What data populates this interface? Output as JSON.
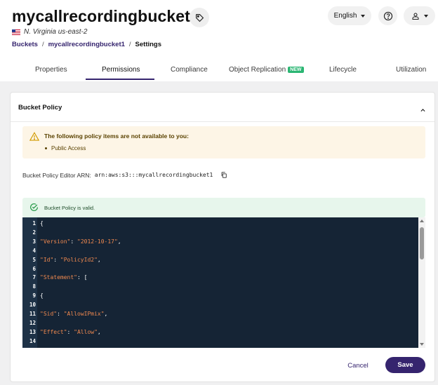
{
  "header": {
    "bucket_name": "mycallrecordingbucket1",
    "region": "N. Virginia us-east-2",
    "language_label": "English"
  },
  "breadcrumb": {
    "root": "Buckets",
    "bucket": "mycallrecordingbucket1",
    "current": "Settings",
    "separator": "/"
  },
  "tabs": [
    {
      "label": "Properties"
    },
    {
      "label": "Permissions"
    },
    {
      "label": "Compliance"
    },
    {
      "label": "Object Replication",
      "badge": "NEW"
    },
    {
      "label": "Lifecycle"
    },
    {
      "label": "Utilization"
    }
  ],
  "active_tab": "Permissions",
  "panel": {
    "title": "Bucket Policy",
    "warning_title": "The following policy items are not available to you:",
    "warning_items": [
      "Public Access"
    ],
    "arn_label": "Bucket Policy Editor ARN:",
    "arn_value": "arn:aws:s3:::mycallrecordingbucket1",
    "valid_message": "Bucket Policy is valid."
  },
  "editor": {
    "line_numbers": [
      "1",
      "2",
      "3",
      "4",
      "5",
      "6",
      "7",
      "8",
      "9",
      "10",
      "11",
      "12",
      "13",
      "14"
    ],
    "lines": [
      {
        "key": "",
        "rest": "{"
      },
      {
        "key": "",
        "rest": ""
      },
      {
        "key": "\"Version\"",
        "rest": ": ",
        "val": "\"2012-10-17\"",
        "tail": ","
      },
      {
        "key": "",
        "rest": ""
      },
      {
        "key": "\"Id\"",
        "rest": ": ",
        "val": "\"PolicyId2\"",
        "tail": ","
      },
      {
        "key": "",
        "rest": ""
      },
      {
        "key": "\"Statement\"",
        "rest": ": [",
        "val": "",
        "tail": ""
      },
      {
        "key": "",
        "rest": ""
      },
      {
        "key": "",
        "rest": "{"
      },
      {
        "key": "",
        "rest": ""
      },
      {
        "key": "\"Sid\"",
        "rest": ": ",
        "val": "\"AllowIPmix\"",
        "tail": ","
      },
      {
        "key": "",
        "rest": ""
      },
      {
        "key": "\"Effect\"",
        "rest": ": ",
        "val": "\"Allow\"",
        "tail": ","
      },
      {
        "key": "",
        "rest": ""
      }
    ]
  },
  "actions": {
    "cancel_label": "Cancel",
    "save_label": "Save"
  },
  "colors": {
    "brand": "#35246e",
    "editor_bg": "#152435",
    "json_key": "#f0894f",
    "warning_bg": "#fdf5e6",
    "valid_bg": "#e7f6ec",
    "new_badge": "#2bb673"
  }
}
